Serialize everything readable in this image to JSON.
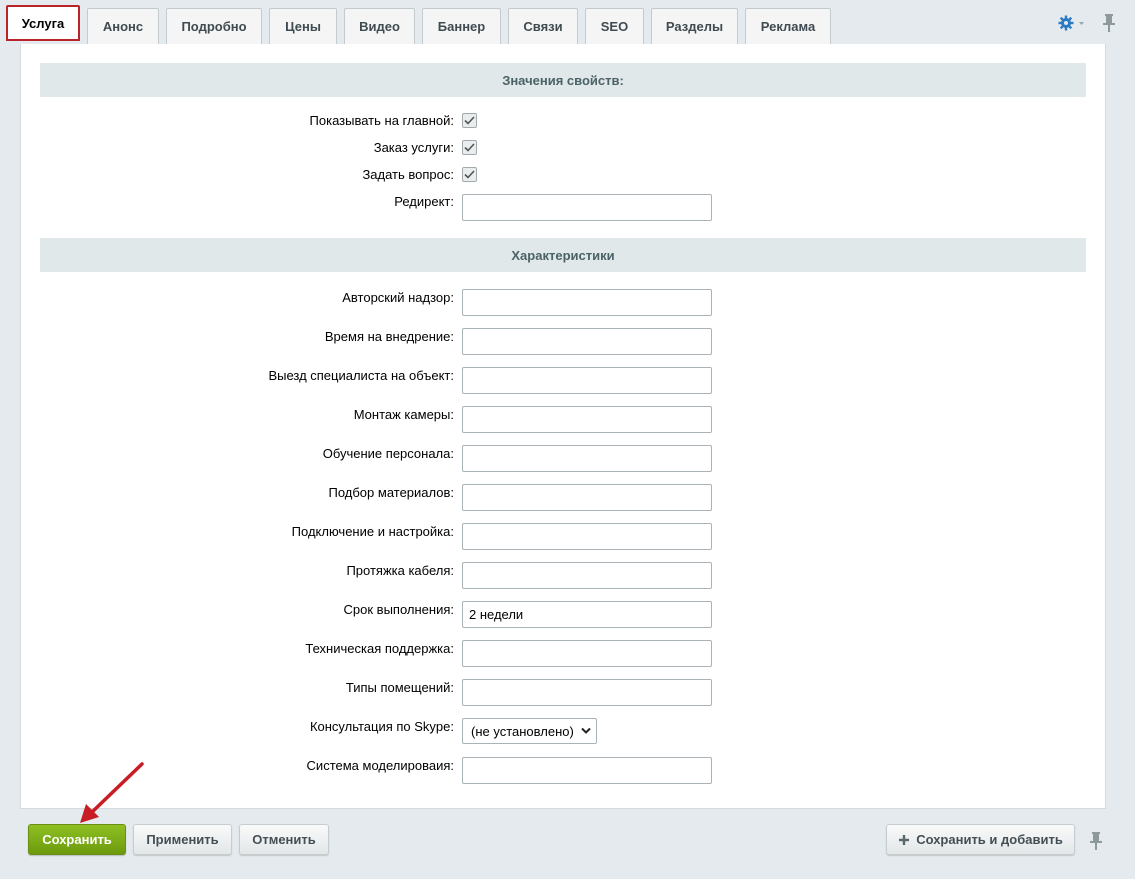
{
  "tabs": [
    "Услуга",
    "Анонс",
    "Подробно",
    "Цены",
    "Видео",
    "Баннер",
    "Связи",
    "SEO",
    "Разделы",
    "Реклама"
  ],
  "sections": {
    "properties_title": "Значения свойств:",
    "characteristics_title": "Характеристики"
  },
  "properties": {
    "show_on_main": "Показывать на главной:",
    "order_service": "Заказ услуги:",
    "ask_question": "Задать вопрос:",
    "redirect": "Редирект:"
  },
  "characteristics": {
    "fields": [
      "Авторский надзор:",
      "Время на внедрение:",
      "Выезд специалиста на объект:",
      "Монтаж камеры:",
      "Обучение персонала:",
      "Подбор материалов:",
      "Подключение и настройка:",
      "Протяжка кабеля:",
      "Срок выполнения:",
      "Техническая поддержка:",
      "Типы помещений:"
    ],
    "term_value": "2 недели",
    "skype_label": "Консультация по Skype:",
    "skype_value": "(не установлено)",
    "modeling_label": "Система моделироваия:"
  },
  "buttons": {
    "save": "Сохранить",
    "apply": "Применить",
    "cancel": "Отменить",
    "save_add": "Сохранить и добавить"
  },
  "colors": {
    "active_tab_border": "#b8242a",
    "save_button": "#7cab17",
    "section_header": "#e0e8ea",
    "gear_icon": "#2b7bc4"
  }
}
